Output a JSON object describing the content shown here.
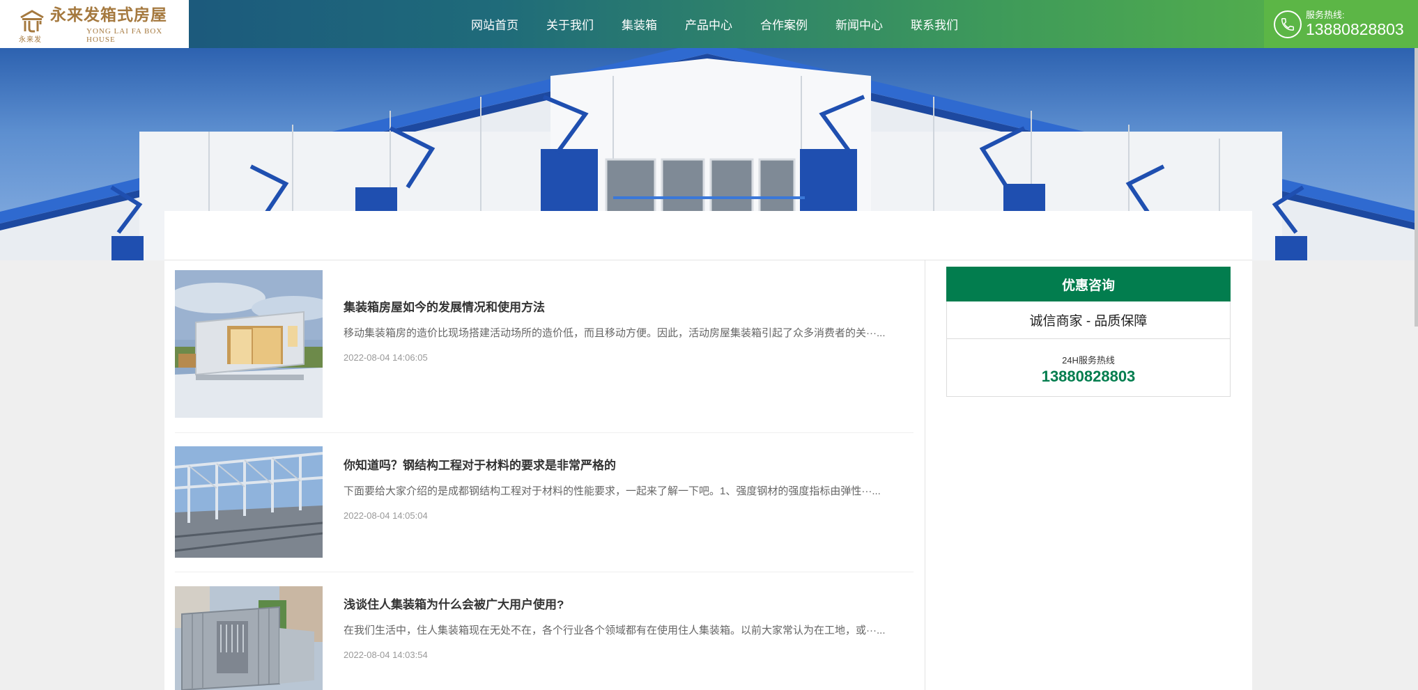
{
  "brand": {
    "name_cn": "永来发箱式房屋",
    "mark_cn": "永来发",
    "name_en": "YONG LAI FA BOX HOUSE",
    "colors": {
      "gold": "#a5793f",
      "green": "#027d4e",
      "accent": "#5cb646"
    }
  },
  "nav": {
    "items": [
      "网站首页",
      "关于我们",
      "集装箱",
      "产品中心",
      "合作案例",
      "新闻中心",
      "联系我们"
    ]
  },
  "hotline": {
    "label": "服务热线:",
    "number": "13880828803",
    "icon": "phone-icon"
  },
  "articles": [
    {
      "title": "集装箱房屋如今的发展情况和使用方法",
      "desc": "移动集装箱房的造价比现场搭建活动场所的造价低，而且移动方便。因此，活动房屋集装箱引起了众多消费者的关···...",
      "date": "2022-08-04 14:06:05"
    },
    {
      "title": "你知道吗？钢结构工程对于材料的要求是非常严格的",
      "desc": "下面要给大家介绍的是成都钢结构工程对于材料的性能要求，一起来了解一下吧。1、强度钢材的强度指标由弹性···...",
      "date": "2022-08-04 14:05:04"
    },
    {
      "title": "浅谈住人集装箱为什么会被广大用户使用?",
      "desc": "在我们生活中，住人集装箱现在无处不在，各个行业各个领域都有在使用住人集装箱。以前大家常认为在工地，或···...",
      "date": "2022-08-04 14:03:54"
    }
  ],
  "sidebar": {
    "title": "优惠咨询",
    "slogan": "诚信商家 - 品质保障",
    "label": "24H服务热线",
    "number": "13880828803"
  }
}
